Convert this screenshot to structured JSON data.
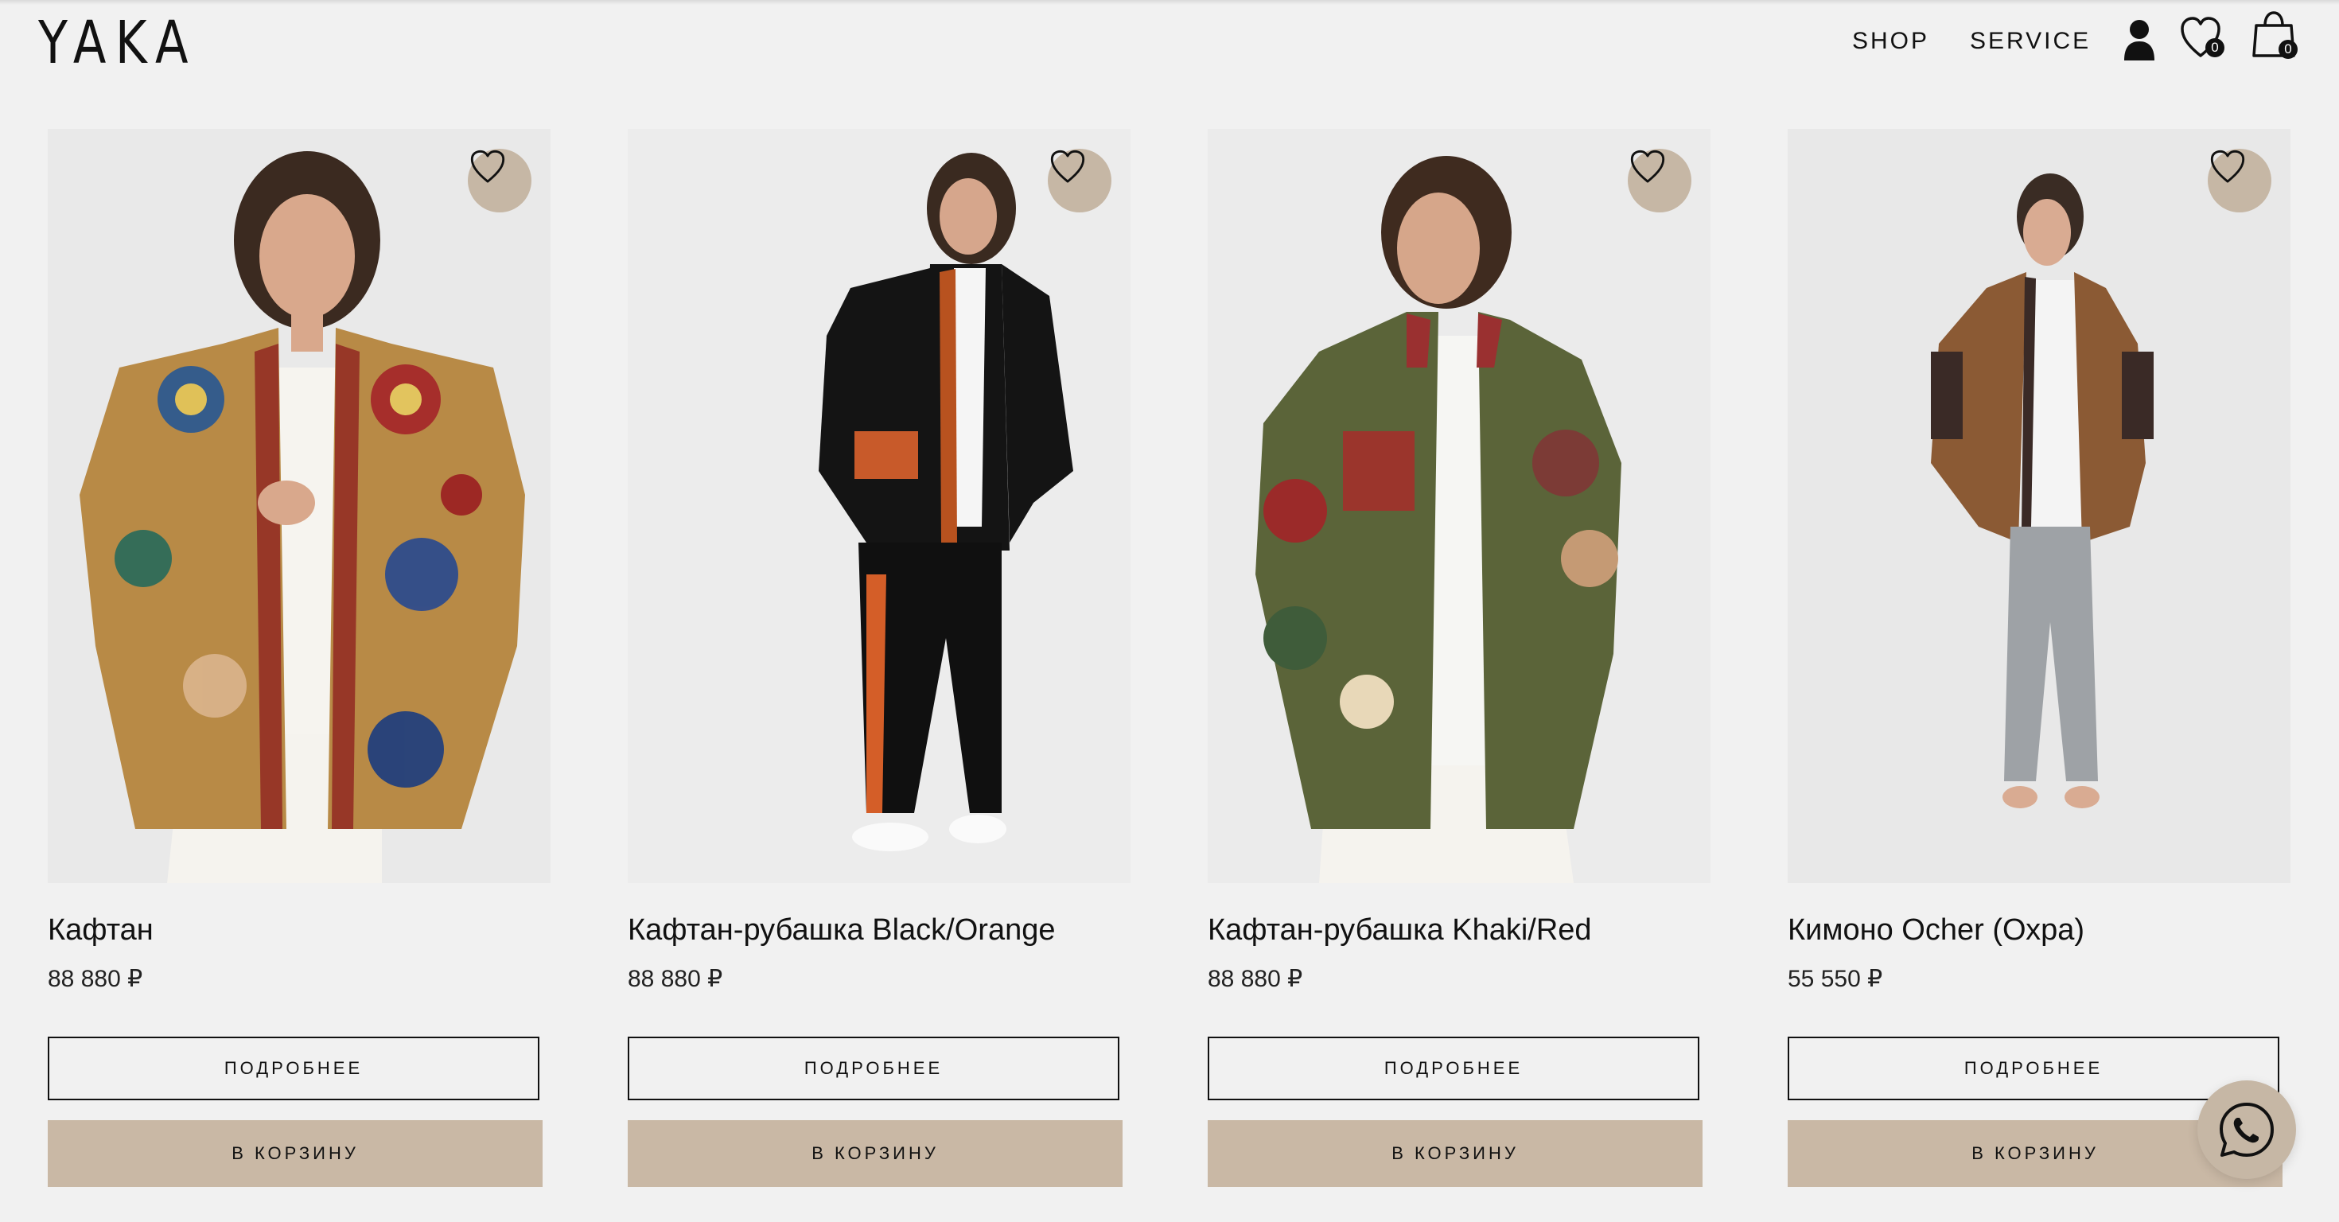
{
  "header": {
    "logo": "YAKA",
    "nav": [
      {
        "label": "SHOP"
      },
      {
        "label": "SERVICE"
      }
    ],
    "icons": {
      "account": "user-icon",
      "wishlist": "heart-icon",
      "cart": "shopping-bag-icon"
    },
    "wishlist_count": "0",
    "cart_count": "0"
  },
  "products": [
    {
      "title": "Кафтан",
      "price": "88 880 ₽",
      "more_label": "ПОДРОБНЕЕ",
      "cart_label": "В КОРЗИНУ",
      "favorite_icon": "heart-icon",
      "garment_color": "#b88a46"
    },
    {
      "title": "Кафтан-рубашка Black/Orange",
      "price": "88 880 ₽",
      "more_label": "ПОДРОБНЕЕ",
      "cart_label": "В КОРЗИНУ",
      "favorite_icon": "heart-icon",
      "garment_color": "#141414"
    },
    {
      "title": "Кафтан-рубашка Khaki/Red",
      "price": "88 880 ₽",
      "more_label": "ПОДРОБНЕЕ",
      "cart_label": "В КОРЗИНУ",
      "favorite_icon": "heart-icon",
      "garment_color": "#5b6439"
    },
    {
      "title": "Кимоно Ocher (Охра)",
      "price": "55 550 ₽",
      "more_label": "ПОДРОБНЕЕ",
      "cart_label": "В КОРЗИНУ",
      "favorite_icon": "heart-icon",
      "garment_color": "#8b5a34"
    }
  ],
  "floating": {
    "whatsapp_icon": "whatsapp-icon"
  },
  "colors": {
    "background": "#f1f1f1",
    "accent_beige": "#c9b8a5",
    "text": "#111111"
  }
}
